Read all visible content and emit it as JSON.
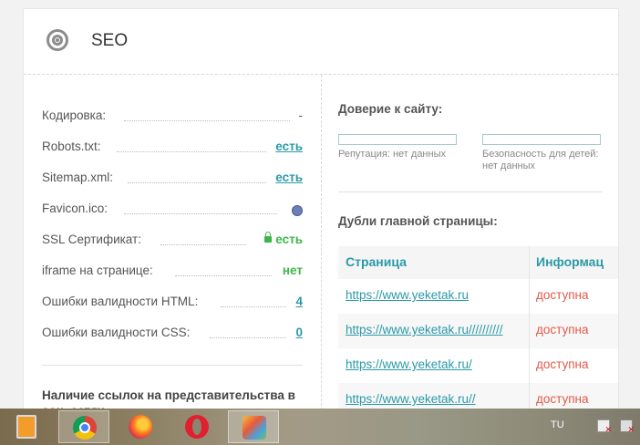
{
  "card": {
    "title": "SEO",
    "icon": "target-icon"
  },
  "left": {
    "rows": [
      {
        "label": "Кодировка:",
        "value": "-",
        "kind": "dash"
      },
      {
        "label": "Robots.txt:",
        "value": "есть",
        "kind": "link"
      },
      {
        "label": "Sitemap.xml:",
        "value": "есть",
        "kind": "link"
      },
      {
        "label": "Favicon.ico:",
        "value": "",
        "kind": "icon",
        "icon": "globe-icon"
      },
      {
        "label": "SSL Сертификат:",
        "value": "есть",
        "kind": "green",
        "icon": "lock-icon"
      },
      {
        "label": "iframe на странице:",
        "value": "нет",
        "kind": "green"
      },
      {
        "label": "Ошибки валидности HTML:",
        "value": "4",
        "kind": "link"
      },
      {
        "label": "Ошибки валидности CSS:",
        "value": "0",
        "kind": "link"
      }
    ],
    "social_title": "Наличие ссылок на представительства в соц. сетях:"
  },
  "right": {
    "trust_title": "Доверие к сайту:",
    "trust": [
      {
        "label": "Репутация: нет данных"
      },
      {
        "label": "Безопасность для детей: нет данных"
      }
    ],
    "dupes_title": "Дубли главной страницы:",
    "table": {
      "headers": [
        "Страница",
        "Информац"
      ],
      "rows": [
        {
          "url": "https://www.yeketak.ru",
          "status": "доступна"
        },
        {
          "url": "https://www.yeketak.ru//////////",
          "status": "доступна"
        },
        {
          "url": "https://www.yeketak.ru/",
          "status": "доступна"
        },
        {
          "url": "https://www.yeketak.ru//",
          "status": "доступна"
        }
      ]
    }
  },
  "taskbar": {
    "apps": [
      "media-player-icon",
      "chrome-icon",
      "firefox-icon",
      "opera-icon",
      "paint-icon"
    ],
    "active_app": "chrome-icon",
    "language": "TU",
    "colors": {
      "link": "#2a9aa8",
      "ok": "#3cb54a",
      "status": "#e05a4a"
    }
  }
}
